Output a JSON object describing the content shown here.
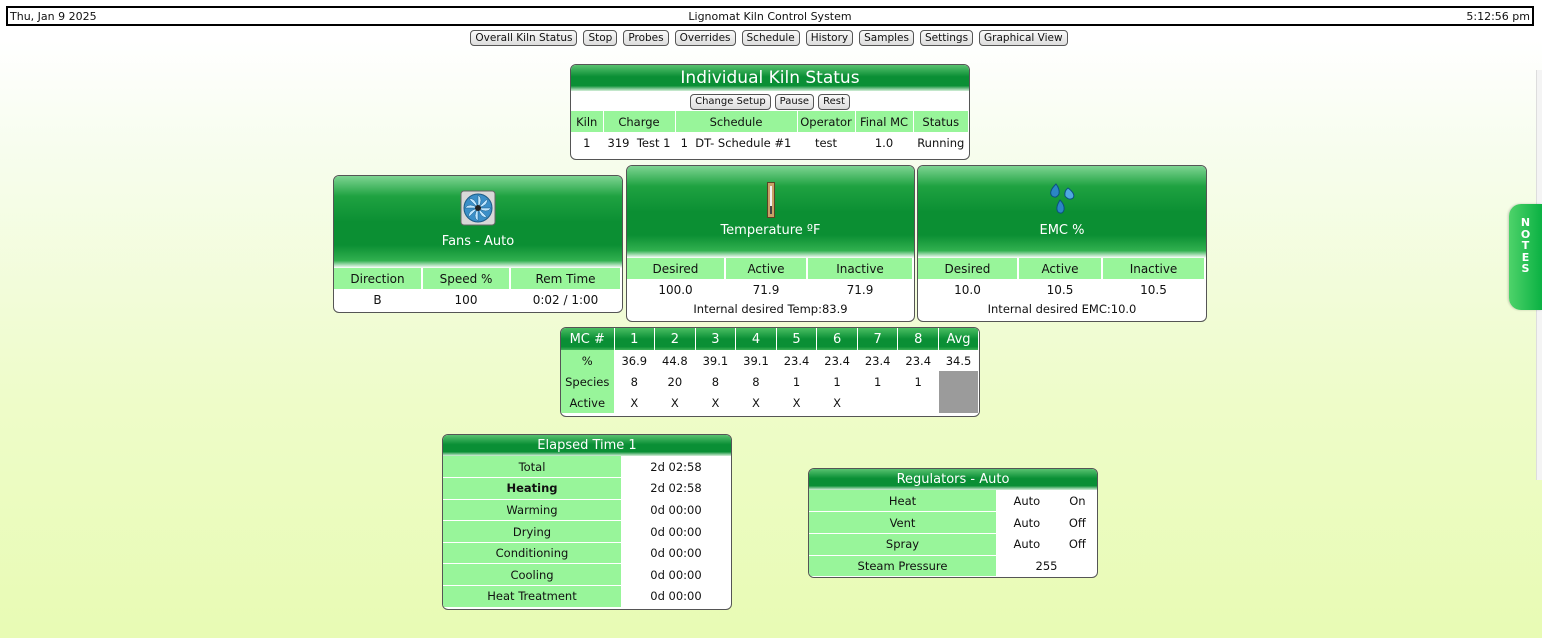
{
  "topbar": {
    "date": "Thu, Jan 9 2025",
    "title": "Lignomat Kiln Control System",
    "time": "5:12:56 pm"
  },
  "nav": [
    "Overall Kiln Status",
    "Stop",
    "Probes",
    "Overrides",
    "Schedule",
    "History",
    "Samples",
    "Settings",
    "Graphical View"
  ],
  "kiln": {
    "title": "Individual Kiln Status",
    "buttons": [
      "Change Setup",
      "Pause",
      "Rest"
    ],
    "headers": [
      "Kiln",
      "Charge",
      "Schedule",
      "Operator",
      "Final MC",
      "Status"
    ],
    "row": {
      "kiln": "1",
      "charge_no": "319",
      "charge_name": "Test 1",
      "schedule_no": "1",
      "schedule_name": "DT- Schedule #1",
      "operator": "test",
      "final_mc": "1.0",
      "status": "Running"
    }
  },
  "fans": {
    "label": "Fans - Auto",
    "headers": [
      "Direction",
      "Speed %",
      "Rem Time"
    ],
    "values": [
      "B",
      "100",
      "0:02 / 1:00"
    ]
  },
  "temperature": {
    "label": "Temperature ºF",
    "headers": [
      "Desired",
      "Active",
      "Inactive"
    ],
    "values": [
      "100.0",
      "71.9",
      "71.9"
    ],
    "note": "Internal desired Temp:83.9"
  },
  "emc": {
    "label": "EMC %",
    "headers": [
      "Desired",
      "Active",
      "Inactive"
    ],
    "values": [
      "10.0",
      "10.5",
      "10.5"
    ],
    "note": "Internal desired EMC:10.0"
  },
  "mc": {
    "header": [
      "MC #",
      "1",
      "2",
      "3",
      "4",
      "5",
      "6",
      "7",
      "8",
      "Avg"
    ],
    "percent": [
      "%",
      "36.9",
      "44.8",
      "39.1",
      "39.1",
      "23.4",
      "23.4",
      "23.4",
      "23.4",
      "34.5"
    ],
    "species": [
      "Species",
      "8",
      "20",
      "8",
      "8",
      "1",
      "1",
      "1",
      "1"
    ],
    "active": [
      "Active",
      "X",
      "X",
      "X",
      "X",
      "X",
      "X",
      "",
      ""
    ]
  },
  "elapsed": {
    "title": "Elapsed Time 1",
    "rows": [
      {
        "label": "Total",
        "value": "2d 02:58"
      },
      {
        "label": "Heating",
        "value": "2d 02:58"
      },
      {
        "label": "Warming",
        "value": "0d 00:00"
      },
      {
        "label": "Drying",
        "value": "0d 00:00"
      },
      {
        "label": "Conditioning",
        "value": "0d 00:00"
      },
      {
        "label": "Cooling",
        "value": "0d 00:00"
      },
      {
        "label": "Heat Treatment",
        "value": "0d 00:00"
      }
    ]
  },
  "regulators": {
    "title": "Regulators - Auto",
    "rows": [
      {
        "label": "Heat",
        "mode": "Auto",
        "state": "On"
      },
      {
        "label": "Vent",
        "mode": "Auto",
        "state": "Off"
      },
      {
        "label": "Spray",
        "mode": "Auto",
        "state": "Off"
      }
    ],
    "steam": {
      "label": "Steam Pressure",
      "value": "255"
    }
  },
  "notes_tab": [
    "N",
    "O",
    "T",
    "E",
    "S"
  ],
  "icons": {
    "fans": "fan-icon",
    "temperature": "thermometer-icon",
    "emc": "water-drops-icon"
  },
  "colors": {
    "green_dark": "#0a8f35",
    "green_light": "#98f59a",
    "notes_green": "#0bb143"
  }
}
